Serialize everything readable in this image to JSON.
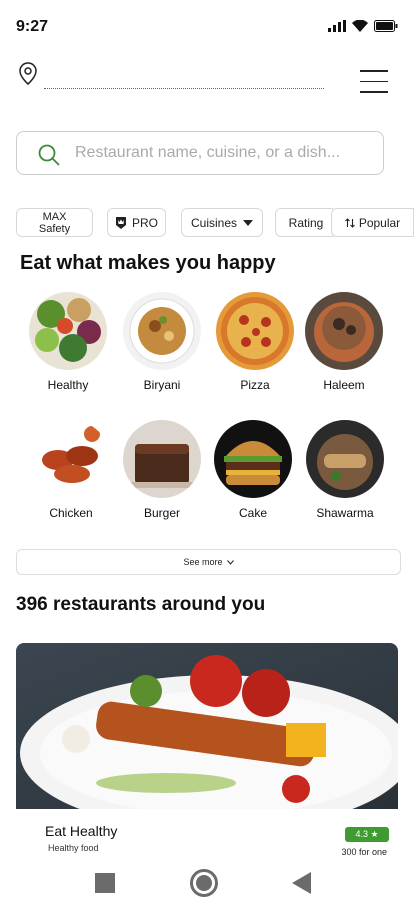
{
  "status": {
    "time": "9:27"
  },
  "search": {
    "placeholder": "Restaurant name, cuisine, or a dish..."
  },
  "filters": {
    "max_line1": "MAX",
    "max_line2": "Safety",
    "pro": "PRO",
    "cuisines": "Cuisines",
    "rating": "Rating",
    "popular": "Popular"
  },
  "section_heading": "Eat what makes you happy",
  "categories": [
    {
      "label": "Healthy"
    },
    {
      "label": "Biryani"
    },
    {
      "label": "Pizza"
    },
    {
      "label": "Haleem"
    },
    {
      "label": "Chicken"
    },
    {
      "label": "Burger"
    },
    {
      "label": "Cake"
    },
    {
      "label": "Shawarma"
    }
  ],
  "see_more": "See more",
  "restaurants_heading": "396 restaurants around you",
  "restaurant": {
    "name": "Eat Healthy",
    "subtitle": "Healthy food",
    "rating": "4.3 ★",
    "price": "300 for one"
  },
  "colors": {
    "rating_green": "#3d9b2f",
    "search_icon_green": "#3c8a3c"
  }
}
